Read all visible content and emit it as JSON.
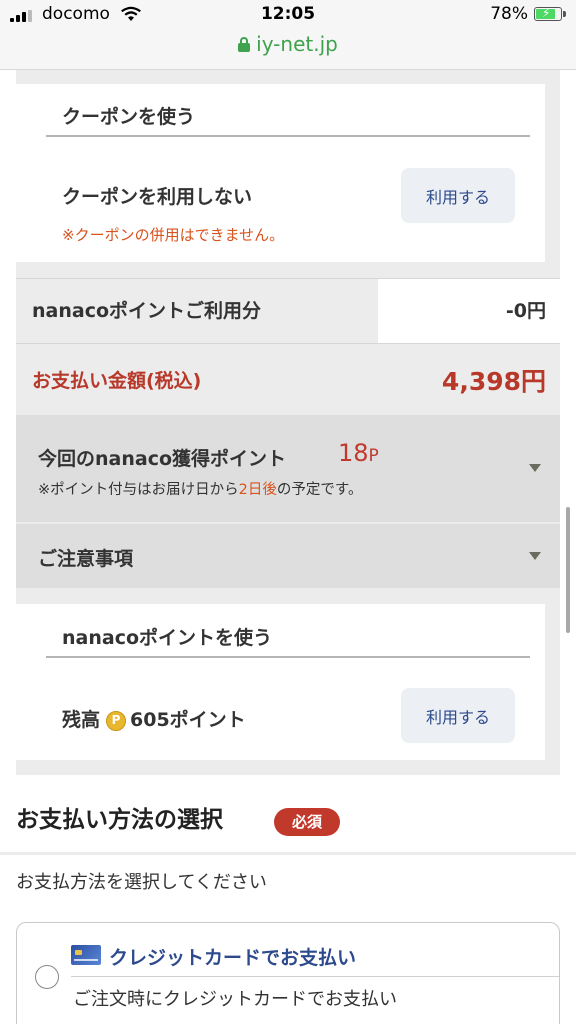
{
  "status_bar": {
    "carrier": "docomo",
    "time": "12:05",
    "battery": "78%",
    "url": "iy-net.jp"
  },
  "coupon": {
    "title": "クーポンを使う",
    "status": "クーポンを利用しない",
    "button": "利用する",
    "note": "※クーポンの併用はできません。"
  },
  "nanaco_discount": {
    "label": "nanacoポイントご利用分",
    "value": "-0円"
  },
  "total": {
    "label": "お支払い金額(税込)",
    "value": "4,398円"
  },
  "earned_points": {
    "label": "今回のnanaco獲得ポイント",
    "value": "18",
    "unit": "P",
    "note_prefix": "※ポイント付与はお届け日から",
    "note_highlight": "2日後",
    "note_suffix": "の予定です。"
  },
  "notice": {
    "label": "ご注意事項"
  },
  "nanaco_use": {
    "title": "nanacoポイントを使う",
    "balance_label": "残高",
    "coin_letter": "P",
    "balance_value": "605ポイント",
    "button": "利用する"
  },
  "payment": {
    "title": "お支払い方法の選択",
    "required_badge": "必須",
    "instruction": "お支払方法を選択してください",
    "options": [
      {
        "label": "クレジットカードでお支払い",
        "description": "ご注文時にクレジットカードでお支払い",
        "icon": "credit-card-icon",
        "selected": false
      }
    ]
  },
  "colors": {
    "accent_red": "#b8382a",
    "link_blue": "#2c4a8c",
    "url_green": "#3fa34d",
    "highlight_orange": "#d9531e"
  }
}
